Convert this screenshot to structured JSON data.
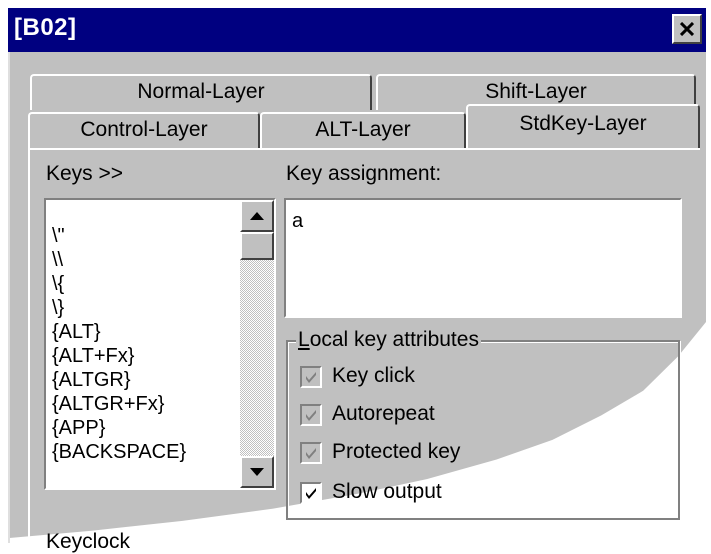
{
  "window": {
    "title": "[B02]",
    "close_glyph": "×"
  },
  "tabs": {
    "row_back": [
      {
        "label": "Normal-Layer"
      },
      {
        "label": "Shift-Layer"
      }
    ],
    "row_front": [
      {
        "label": "Control-Layer"
      },
      {
        "label": "ALT-Layer"
      },
      {
        "label": "StdKey-Layer"
      }
    ],
    "active": "StdKey-Layer"
  },
  "keys": {
    "label": "Keys >>",
    "items": [
      "\\\"",
      "\\\\",
      "\\{",
      "\\}",
      "{ALT}",
      "{ALT+Fx}",
      "{ALTGR}",
      "{ALTGR+Fx}",
      "{APP}",
      "{BACKSPACE}"
    ]
  },
  "assignment": {
    "label": "Key assignment:",
    "value": "a"
  },
  "attributes": {
    "title": "Local key attributes",
    "options": [
      {
        "label": "Key click",
        "checked": true,
        "enabled": false
      },
      {
        "label": "Autorepeat",
        "checked": true,
        "enabled": false
      },
      {
        "label": "Protected key",
        "checked": true,
        "enabled": false
      },
      {
        "label": "Slow output",
        "checked": true,
        "enabled": true
      }
    ]
  },
  "footer": {
    "label": "Keyclock"
  },
  "colors": {
    "titlebar": "#000080",
    "face": "#c0c0c0"
  }
}
